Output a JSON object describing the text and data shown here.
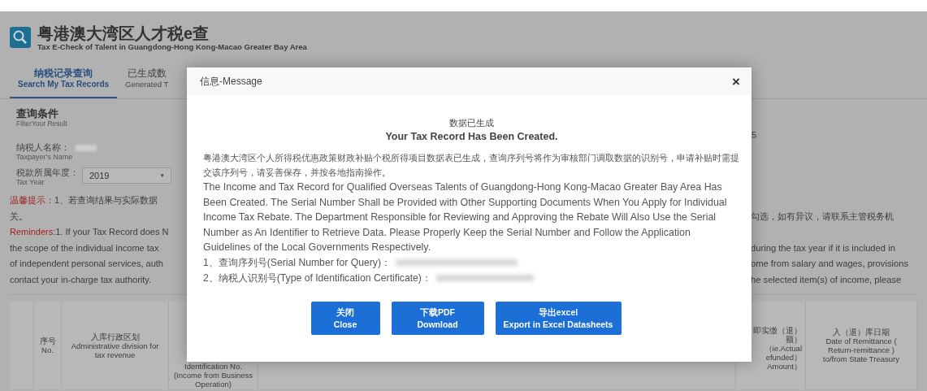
{
  "header": {
    "title": "粤港澳大湾区人才税e查",
    "subtitle": "Tax E-Check of Talent in Guangdong-Hong Kong-Macao Greater Bay Area"
  },
  "tabs": [
    {
      "label": "纳税记录查询",
      "sublabel": "Search My Tax Records",
      "selected": true
    },
    {
      "label": "已生成数",
      "sublabel": "Generated T",
      "selected": false
    }
  ],
  "filter": {
    "title": "查询条件",
    "subtitle": "FilterYour Result",
    "fields": [
      {
        "kind": "text",
        "label": "纳税人名称：",
        "sublabel": "Taxpayer's Name"
      },
      {
        "kind": "select",
        "label": "税款所属年度：",
        "sublabel": "Tax Year",
        "value": "2019",
        "caret": "▾"
      }
    ],
    "fragment": "5"
  },
  "reminders": {
    "cn_label": "温馨提示：",
    "cn_left": [
      "1、若查询结果与实际数据",
      "关。"
    ],
    "cn_right": "勾选，如有异议，请联系主管税务机",
    "en_label": "Reminders:",
    "en_left": [
      "1. If your Tax Record does N",
      "the scope of the individual income tax",
      "of independent personal services, auth",
      "contact your in-charge tax authority."
    ],
    "en_right": [
      "during the tax year if it is included in",
      "ome from salary and wages, provisions",
      "he selected item(s) of income, please"
    ]
  },
  "table": {
    "columns_left": [
      {
        "cn": "序号",
        "en": "No."
      },
      {
        "cn": "入库行政区划",
        "en": "Administrative division for tax revenue"
      },
      {
        "en": "Identification No. (Income from Business Operation)"
      }
    ],
    "columns_right": [
      {
        "lines": [
          "即实缴（退）",
          "额）",
          "（ie.Actual",
          "efunded）",
          "Amount）"
        ]
      },
      {
        "cn": "入（退）库日期",
        "en": "Date of Remittance ( Return-remittance ) to/from State Treasury"
      }
    ]
  },
  "dialog": {
    "title": "信息-Message",
    "close": "×",
    "heading_cn": "数据已生成",
    "heading_en": "Your Tax Record Has Been Created.",
    "body_cn": "粤港澳大湾区个人所得税优惠政策财政补贴个税所得项目数据表已生成，查询序列号将作为审核部门调取数据的识别号，申请补贴时需提交该序列号，请妥善保存，并按各地指南操作。",
    "body_en": "The Income and Tax Record for Qualified Overseas Talents of Guangdong-Hong Kong-Macao Greater Bay Area Has Been Created. The Serial Number Shall be Provided with Other Supporting Documents When You Apply for Individual Income Tax Rebate. The Department Responsible for Reviewing and Approving the Rebate Will Also Use the Serial Number as An Identifier to Retrieve Data. Please Properly Keep the Serial Number and Follow the Application Guidelines of the Local Governments Respectively.",
    "items": [
      "1、查询序列号(Serial Number for Query)：",
      "2、纳税人识别号(Type of Identification Certificate)："
    ],
    "buttons": [
      {
        "cn": "关闭",
        "en": "Close"
      },
      {
        "cn": "下载PDF",
        "en": "Download"
      },
      {
        "cn": "导出excel",
        "en": "Export in Excel Datasheets"
      }
    ]
  }
}
